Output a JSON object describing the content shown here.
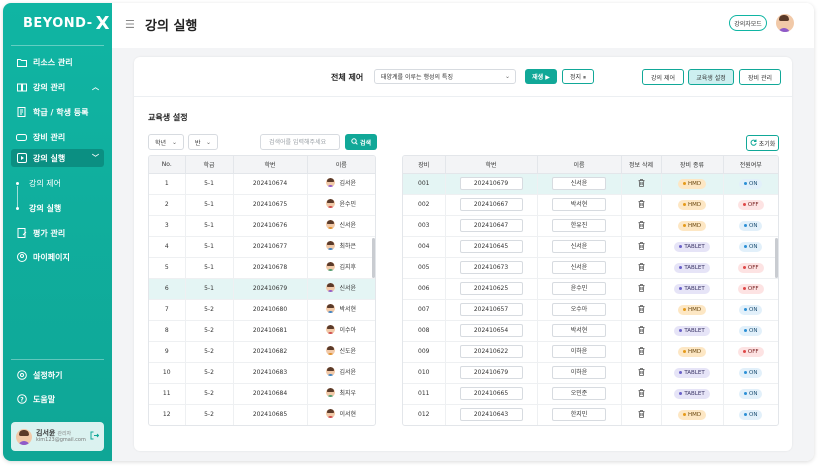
{
  "app": {
    "logo_text": "BEYOND-",
    "logo_x": "X"
  },
  "sidebar": {
    "items": [
      {
        "label": "리소스 관리",
        "icon": "folder-icon"
      },
      {
        "label": "강의 관리",
        "icon": "book-icon",
        "chevron": "^"
      },
      {
        "label": "학급 / 학생 등록",
        "icon": "register-icon"
      },
      {
        "label": "장비 관리",
        "icon": "device-icon"
      },
      {
        "label": "강의 실행",
        "icon": "play-icon",
        "chevron": "v"
      },
      {
        "label": "평가 관리",
        "icon": "evaluation-icon"
      },
      {
        "label": "마이페이지",
        "icon": "user-icon"
      }
    ],
    "sub_items": [
      {
        "label": "강의 제어"
      },
      {
        "label": "강의 실행"
      }
    ],
    "bottom_items": [
      {
        "label": "설정하기",
        "icon": "gear-icon"
      },
      {
        "label": "도움말",
        "icon": "help-icon"
      }
    ],
    "user": {
      "name": "김서윤",
      "role": "관리자",
      "email": "kim123@gmail.com"
    }
  },
  "header": {
    "title": "강의 실행",
    "remote_label": "강의자모드"
  },
  "control": {
    "label": "전체 제어",
    "lecture_value": "태양계를 이루는 행성의 특징",
    "play_label": "재생 ▶",
    "stop_label": "정지 ⏸",
    "modes": [
      "강의 제어",
      "교육생 설정",
      "장비 관리"
    ],
    "active_mode": "교육생 설정"
  },
  "section": {
    "title": "교육생 설정"
  },
  "filters": {
    "grade": "학년",
    "class": "반",
    "search_placeholder": "검색어를 입력해주세요",
    "search_label": "검색",
    "reset_label": "초기화"
  },
  "student_table": {
    "headers": [
      "No.",
      "학급",
      "학번",
      "이름"
    ],
    "rows": [
      {
        "no": "1",
        "class": "5-1",
        "id": "202410674",
        "name": "김서윤"
      },
      {
        "no": "2",
        "class": "5-1",
        "id": "202410675",
        "name": "윤수민"
      },
      {
        "no": "3",
        "class": "5-1",
        "id": "202410676",
        "name": "신서윤"
      },
      {
        "no": "4",
        "class": "5-1",
        "id": "202410677",
        "name": "최하은"
      },
      {
        "no": "5",
        "class": "5-1",
        "id": "202410678",
        "name": "김지후"
      },
      {
        "no": "6",
        "class": "5-1",
        "id": "202410679",
        "name": "신서윤"
      },
      {
        "no": "7",
        "class": "5-2",
        "id": "202410680",
        "name": "박서현"
      },
      {
        "no": "8",
        "class": "5-2",
        "id": "202410681",
        "name": "이수아"
      },
      {
        "no": "9",
        "class": "5-2",
        "id": "202410682",
        "name": "신도윤"
      },
      {
        "no": "10",
        "class": "5-2",
        "id": "202410683",
        "name": "김서윤"
      },
      {
        "no": "11",
        "class": "5-2",
        "id": "202410684",
        "name": "최지우"
      },
      {
        "no": "12",
        "class": "5-2",
        "id": "202410685",
        "name": "이서현"
      }
    ]
  },
  "device_table": {
    "headers": [
      "장비",
      "학번",
      "이름",
      "정보 삭제",
      "장비 종류",
      "전원여부"
    ],
    "rows": [
      {
        "device": "001",
        "id": "202410679",
        "name": "신서윤",
        "type": "HMD",
        "power": "ON"
      },
      {
        "device": "002",
        "id": "202410667",
        "name": "박서현",
        "type": "HMD",
        "power": "OFF"
      },
      {
        "device": "003",
        "id": "202410647",
        "name": "한유진",
        "type": "HMD",
        "power": "ON"
      },
      {
        "device": "004",
        "id": "202410645",
        "name": "신서윤",
        "type": "TABLET",
        "power": "ON"
      },
      {
        "device": "005",
        "id": "202410673",
        "name": "신서윤",
        "type": "TABLET",
        "power": "OFF"
      },
      {
        "device": "006",
        "id": "202410625",
        "name": "윤수민",
        "type": "TABLET",
        "power": "OFF"
      },
      {
        "device": "007",
        "id": "202410657",
        "name": "오수아",
        "type": "HMD",
        "power": "ON"
      },
      {
        "device": "008",
        "id": "202410654",
        "name": "박서현",
        "type": "TABLET",
        "power": "ON"
      },
      {
        "device": "009",
        "id": "202410622",
        "name": "이하윤",
        "type": "HMD",
        "power": "OFF"
      },
      {
        "device": "010",
        "id": "202410679",
        "name": "이하윤",
        "type": "TABLET",
        "power": "ON"
      },
      {
        "device": "011",
        "id": "202410665",
        "name": "오민준",
        "type": "TABLET",
        "power": "ON"
      },
      {
        "device": "012",
        "id": "202410643",
        "name": "한지민",
        "type": "HMD",
        "power": "ON"
      }
    ]
  },
  "colors": {
    "accent": "#11a898",
    "sidebar": "#10b5a3",
    "selected_row": "#e4f5f4"
  }
}
